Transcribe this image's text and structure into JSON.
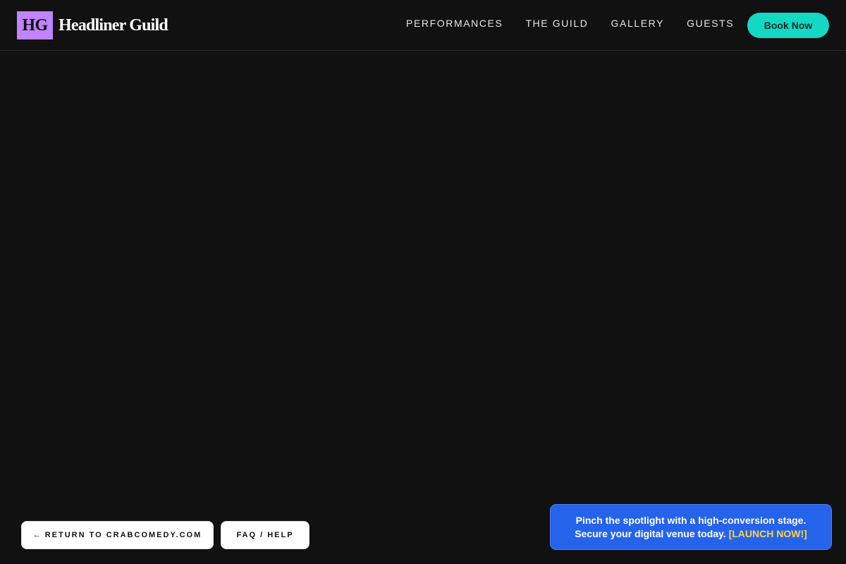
{
  "header": {
    "logo_mark": "HG",
    "brand_name": "Headliner Guild",
    "nav": [
      {
        "label": "PERFORMANCES"
      },
      {
        "label": "THE GUILD"
      },
      {
        "label": "GALLERY"
      },
      {
        "label": "GUESTS"
      }
    ],
    "cta_label": "Book Now"
  },
  "footer_buttons": {
    "return_arrow": "←",
    "return_label": "RETURN TO CRABCOMEDY.COM",
    "faq_label": "FAQ / HELP"
  },
  "promo": {
    "line1": "Pinch the spotlight with a high-conversion stage.",
    "line2": "Secure your digital venue today.",
    "link_label": "[LAUNCH NOW!]"
  },
  "colors": {
    "background": "#111111",
    "logo_accent": "#c084fc",
    "cta": "#14d8c4",
    "promo_bg": "#2563eb",
    "promo_link": "#fcd34d"
  }
}
